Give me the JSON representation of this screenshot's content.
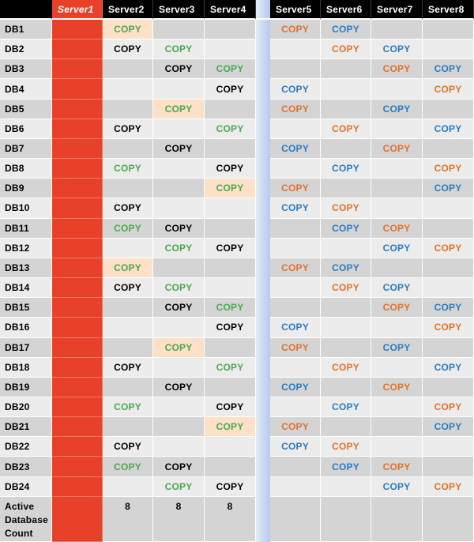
{
  "table": {
    "corner_label": "",
    "servers": [
      "Server1",
      "Server2",
      "Server3",
      "Server4",
      "Server5",
      "Server6",
      "Server7",
      "Server8"
    ],
    "highlight_server": "Server1",
    "colors": {
      "header_bg": "#000000",
      "header_text": "#ffffff",
      "offline_server": "#e8412a",
      "row_odd": "#d4d4d4",
      "row_even": "#ececec",
      "highlight_cell": "#fce0c8",
      "separator": "#c9d8f0",
      "copy_black": "#000000",
      "copy_green": "#4aa84f",
      "copy_orange": "#e0722a",
      "copy_blue": "#2b7bc0"
    },
    "copy_text": "COPY",
    "rows": [
      {
        "db": "DB1",
        "cells": {
          "Server2": {
            "color": "green",
            "highlight": true
          },
          "Server5": {
            "color": "orange"
          },
          "Server6": {
            "color": "blue"
          }
        }
      },
      {
        "db": "DB2",
        "cells": {
          "Server2": {
            "color": "black"
          },
          "Server3": {
            "color": "green"
          },
          "Server6": {
            "color": "orange"
          },
          "Server7": {
            "color": "blue"
          }
        }
      },
      {
        "db": "DB3",
        "cells": {
          "Server3": {
            "color": "black"
          },
          "Server4": {
            "color": "green"
          },
          "Server7": {
            "color": "orange"
          },
          "Server8": {
            "color": "blue"
          }
        }
      },
      {
        "db": "DB4",
        "cells": {
          "Server4": {
            "color": "black"
          },
          "Server5": {
            "color": "blue"
          },
          "Server8": {
            "color": "orange"
          }
        }
      },
      {
        "db": "DB5",
        "cells": {
          "Server3": {
            "color": "green",
            "highlight": true
          },
          "Server5": {
            "color": "orange"
          },
          "Server7": {
            "color": "blue"
          }
        }
      },
      {
        "db": "DB6",
        "cells": {
          "Server2": {
            "color": "black"
          },
          "Server4": {
            "color": "green"
          },
          "Server6": {
            "color": "orange"
          },
          "Server8": {
            "color": "blue"
          }
        }
      },
      {
        "db": "DB7",
        "cells": {
          "Server3": {
            "color": "black"
          },
          "Server5": {
            "color": "blue"
          },
          "Server7": {
            "color": "orange"
          }
        }
      },
      {
        "db": "DB8",
        "cells": {
          "Server2": {
            "color": "green"
          },
          "Server4": {
            "color": "black"
          },
          "Server6": {
            "color": "blue"
          },
          "Server8": {
            "color": "orange"
          }
        }
      },
      {
        "db": "DB9",
        "cells": {
          "Server4": {
            "color": "green",
            "highlight": true
          },
          "Server5": {
            "color": "orange"
          },
          "Server8": {
            "color": "blue"
          }
        }
      },
      {
        "db": "DB10",
        "cells": {
          "Server2": {
            "color": "black"
          },
          "Server5": {
            "color": "blue"
          },
          "Server6": {
            "color": "orange"
          }
        }
      },
      {
        "db": "DB11",
        "cells": {
          "Server2": {
            "color": "green"
          },
          "Server3": {
            "color": "black"
          },
          "Server6": {
            "color": "blue"
          },
          "Server7": {
            "color": "orange"
          }
        }
      },
      {
        "db": "DB12",
        "cells": {
          "Server3": {
            "color": "green"
          },
          "Server4": {
            "color": "black"
          },
          "Server7": {
            "color": "blue"
          },
          "Server8": {
            "color": "orange"
          }
        }
      },
      {
        "db": "DB13",
        "cells": {
          "Server2": {
            "color": "green",
            "highlight": true
          },
          "Server5": {
            "color": "orange"
          },
          "Server6": {
            "color": "blue"
          }
        }
      },
      {
        "db": "DB14",
        "cells": {
          "Server2": {
            "color": "black"
          },
          "Server3": {
            "color": "green"
          },
          "Server6": {
            "color": "orange"
          },
          "Server7": {
            "color": "blue"
          }
        }
      },
      {
        "db": "DB15",
        "cells": {
          "Server3": {
            "color": "black"
          },
          "Server4": {
            "color": "green"
          },
          "Server7": {
            "color": "orange"
          },
          "Server8": {
            "color": "blue"
          }
        }
      },
      {
        "db": "DB16",
        "cells": {
          "Server4": {
            "color": "black"
          },
          "Server5": {
            "color": "blue"
          },
          "Server8": {
            "color": "orange"
          }
        }
      },
      {
        "db": "DB17",
        "cells": {
          "Server3": {
            "color": "green",
            "highlight": true
          },
          "Server5": {
            "color": "orange"
          },
          "Server7": {
            "color": "blue"
          }
        }
      },
      {
        "db": "DB18",
        "cells": {
          "Server2": {
            "color": "black"
          },
          "Server4": {
            "color": "green"
          },
          "Server6": {
            "color": "orange"
          },
          "Server8": {
            "color": "blue"
          }
        }
      },
      {
        "db": "DB19",
        "cells": {
          "Server3": {
            "color": "black"
          },
          "Server5": {
            "color": "blue"
          },
          "Server7": {
            "color": "orange"
          }
        }
      },
      {
        "db": "DB20",
        "cells": {
          "Server2": {
            "color": "green"
          },
          "Server4": {
            "color": "black"
          },
          "Server6": {
            "color": "blue"
          },
          "Server8": {
            "color": "orange"
          }
        }
      },
      {
        "db": "DB21",
        "cells": {
          "Server4": {
            "color": "green",
            "highlight": true
          },
          "Server5": {
            "color": "orange"
          },
          "Server8": {
            "color": "blue"
          }
        }
      },
      {
        "db": "DB22",
        "cells": {
          "Server2": {
            "color": "black"
          },
          "Server5": {
            "color": "blue"
          },
          "Server6": {
            "color": "orange"
          }
        }
      },
      {
        "db": "DB23",
        "cells": {
          "Server2": {
            "color": "green"
          },
          "Server3": {
            "color": "black"
          },
          "Server6": {
            "color": "blue"
          },
          "Server7": {
            "color": "orange"
          }
        }
      },
      {
        "db": "DB24",
        "cells": {
          "Server3": {
            "color": "green"
          },
          "Server4": {
            "color": "black"
          },
          "Server7": {
            "color": "blue"
          },
          "Server8": {
            "color": "orange"
          }
        }
      }
    ],
    "footer": {
      "label": "Active\nDatabase\nCount",
      "values": {
        "Server1": "",
        "Server2": "8",
        "Server3": "8",
        "Server4": "8",
        "Server5": "",
        "Server6": "",
        "Server7": "",
        "Server8": ""
      }
    }
  }
}
